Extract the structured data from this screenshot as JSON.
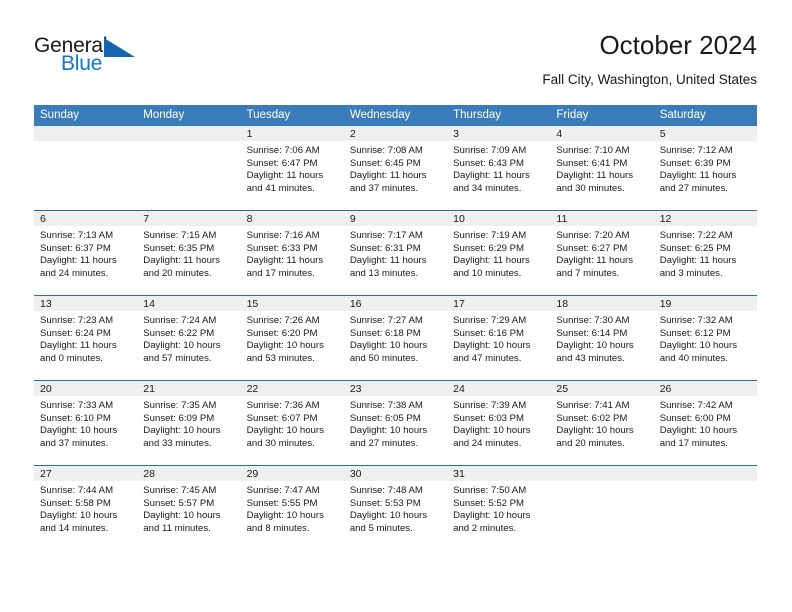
{
  "brand": {
    "name_part1": "General",
    "name_part2": "Blue",
    "accent_color": "#1676c8"
  },
  "header": {
    "title": "October 2024",
    "subtitle": "Fall City, Washington, United States"
  },
  "theme": {
    "header_row_color": "#3a7cba",
    "grid_line_color": "#2e6da4",
    "daynum_band_color": "#efefef"
  },
  "weekday_headers": [
    "Sunday",
    "Monday",
    "Tuesday",
    "Wednesday",
    "Thursday",
    "Friday",
    "Saturday"
  ],
  "weeks": [
    [
      {
        "day": "",
        "sunrise": "",
        "sunset": "",
        "daylight_line1": "",
        "daylight_line2": "",
        "empty": true
      },
      {
        "day": "",
        "sunrise": "",
        "sunset": "",
        "daylight_line1": "",
        "daylight_line2": "",
        "empty": true
      },
      {
        "day": "1",
        "sunrise": "Sunrise: 7:06 AM",
        "sunset": "Sunset: 6:47 PM",
        "daylight_line1": "Daylight: 11 hours",
        "daylight_line2": "and 41 minutes."
      },
      {
        "day": "2",
        "sunrise": "Sunrise: 7:08 AM",
        "sunset": "Sunset: 6:45 PM",
        "daylight_line1": "Daylight: 11 hours",
        "daylight_line2": "and 37 minutes."
      },
      {
        "day": "3",
        "sunrise": "Sunrise: 7:09 AM",
        "sunset": "Sunset: 6:43 PM",
        "daylight_line1": "Daylight: 11 hours",
        "daylight_line2": "and 34 minutes."
      },
      {
        "day": "4",
        "sunrise": "Sunrise: 7:10 AM",
        "sunset": "Sunset: 6:41 PM",
        "daylight_line1": "Daylight: 11 hours",
        "daylight_line2": "and 30 minutes."
      },
      {
        "day": "5",
        "sunrise": "Sunrise: 7:12 AM",
        "sunset": "Sunset: 6:39 PM",
        "daylight_line1": "Daylight: 11 hours",
        "daylight_line2": "and 27 minutes."
      }
    ],
    [
      {
        "day": "6",
        "sunrise": "Sunrise: 7:13 AM",
        "sunset": "Sunset: 6:37 PM",
        "daylight_line1": "Daylight: 11 hours",
        "daylight_line2": "and 24 minutes."
      },
      {
        "day": "7",
        "sunrise": "Sunrise: 7:15 AM",
        "sunset": "Sunset: 6:35 PM",
        "daylight_line1": "Daylight: 11 hours",
        "daylight_line2": "and 20 minutes."
      },
      {
        "day": "8",
        "sunrise": "Sunrise: 7:16 AM",
        "sunset": "Sunset: 6:33 PM",
        "daylight_line1": "Daylight: 11 hours",
        "daylight_line2": "and 17 minutes."
      },
      {
        "day": "9",
        "sunrise": "Sunrise: 7:17 AM",
        "sunset": "Sunset: 6:31 PM",
        "daylight_line1": "Daylight: 11 hours",
        "daylight_line2": "and 13 minutes."
      },
      {
        "day": "10",
        "sunrise": "Sunrise: 7:19 AM",
        "sunset": "Sunset: 6:29 PM",
        "daylight_line1": "Daylight: 11 hours",
        "daylight_line2": "and 10 minutes."
      },
      {
        "day": "11",
        "sunrise": "Sunrise: 7:20 AM",
        "sunset": "Sunset: 6:27 PM",
        "daylight_line1": "Daylight: 11 hours",
        "daylight_line2": "and 7 minutes."
      },
      {
        "day": "12",
        "sunrise": "Sunrise: 7:22 AM",
        "sunset": "Sunset: 6:25 PM",
        "daylight_line1": "Daylight: 11 hours",
        "daylight_line2": "and 3 minutes."
      }
    ],
    [
      {
        "day": "13",
        "sunrise": "Sunrise: 7:23 AM",
        "sunset": "Sunset: 6:24 PM",
        "daylight_line1": "Daylight: 11 hours",
        "daylight_line2": "and 0 minutes."
      },
      {
        "day": "14",
        "sunrise": "Sunrise: 7:24 AM",
        "sunset": "Sunset: 6:22 PM",
        "daylight_line1": "Daylight: 10 hours",
        "daylight_line2": "and 57 minutes."
      },
      {
        "day": "15",
        "sunrise": "Sunrise: 7:26 AM",
        "sunset": "Sunset: 6:20 PM",
        "daylight_line1": "Daylight: 10 hours",
        "daylight_line2": "and 53 minutes."
      },
      {
        "day": "16",
        "sunrise": "Sunrise: 7:27 AM",
        "sunset": "Sunset: 6:18 PM",
        "daylight_line1": "Daylight: 10 hours",
        "daylight_line2": "and 50 minutes."
      },
      {
        "day": "17",
        "sunrise": "Sunrise: 7:29 AM",
        "sunset": "Sunset: 6:16 PM",
        "daylight_line1": "Daylight: 10 hours",
        "daylight_line2": "and 47 minutes."
      },
      {
        "day": "18",
        "sunrise": "Sunrise: 7:30 AM",
        "sunset": "Sunset: 6:14 PM",
        "daylight_line1": "Daylight: 10 hours",
        "daylight_line2": "and 43 minutes."
      },
      {
        "day": "19",
        "sunrise": "Sunrise: 7:32 AM",
        "sunset": "Sunset: 6:12 PM",
        "daylight_line1": "Daylight: 10 hours",
        "daylight_line2": "and 40 minutes."
      }
    ],
    [
      {
        "day": "20",
        "sunrise": "Sunrise: 7:33 AM",
        "sunset": "Sunset: 6:10 PM",
        "daylight_line1": "Daylight: 10 hours",
        "daylight_line2": "and 37 minutes."
      },
      {
        "day": "21",
        "sunrise": "Sunrise: 7:35 AM",
        "sunset": "Sunset: 6:09 PM",
        "daylight_line1": "Daylight: 10 hours",
        "daylight_line2": "and 33 minutes."
      },
      {
        "day": "22",
        "sunrise": "Sunrise: 7:36 AM",
        "sunset": "Sunset: 6:07 PM",
        "daylight_line1": "Daylight: 10 hours",
        "daylight_line2": "and 30 minutes."
      },
      {
        "day": "23",
        "sunrise": "Sunrise: 7:38 AM",
        "sunset": "Sunset: 6:05 PM",
        "daylight_line1": "Daylight: 10 hours",
        "daylight_line2": "and 27 minutes."
      },
      {
        "day": "24",
        "sunrise": "Sunrise: 7:39 AM",
        "sunset": "Sunset: 6:03 PM",
        "daylight_line1": "Daylight: 10 hours",
        "daylight_line2": "and 24 minutes."
      },
      {
        "day": "25",
        "sunrise": "Sunrise: 7:41 AM",
        "sunset": "Sunset: 6:02 PM",
        "daylight_line1": "Daylight: 10 hours",
        "daylight_line2": "and 20 minutes."
      },
      {
        "day": "26",
        "sunrise": "Sunrise: 7:42 AM",
        "sunset": "Sunset: 6:00 PM",
        "daylight_line1": "Daylight: 10 hours",
        "daylight_line2": "and 17 minutes."
      }
    ],
    [
      {
        "day": "27",
        "sunrise": "Sunrise: 7:44 AM",
        "sunset": "Sunset: 5:58 PM",
        "daylight_line1": "Daylight: 10 hours",
        "daylight_line2": "and 14 minutes."
      },
      {
        "day": "28",
        "sunrise": "Sunrise: 7:45 AM",
        "sunset": "Sunset: 5:57 PM",
        "daylight_line1": "Daylight: 10 hours",
        "daylight_line2": "and 11 minutes."
      },
      {
        "day": "29",
        "sunrise": "Sunrise: 7:47 AM",
        "sunset": "Sunset: 5:55 PM",
        "daylight_line1": "Daylight: 10 hours",
        "daylight_line2": "and 8 minutes."
      },
      {
        "day": "30",
        "sunrise": "Sunrise: 7:48 AM",
        "sunset": "Sunset: 5:53 PM",
        "daylight_line1": "Daylight: 10 hours",
        "daylight_line2": "and 5 minutes."
      },
      {
        "day": "31",
        "sunrise": "Sunrise: 7:50 AM",
        "sunset": "Sunset: 5:52 PM",
        "daylight_line1": "Daylight: 10 hours",
        "daylight_line2": "and 2 minutes."
      },
      {
        "day": "",
        "sunrise": "",
        "sunset": "",
        "daylight_line1": "",
        "daylight_line2": "",
        "empty": true
      },
      {
        "day": "",
        "sunrise": "",
        "sunset": "",
        "daylight_line1": "",
        "daylight_line2": "",
        "empty": true
      }
    ]
  ]
}
